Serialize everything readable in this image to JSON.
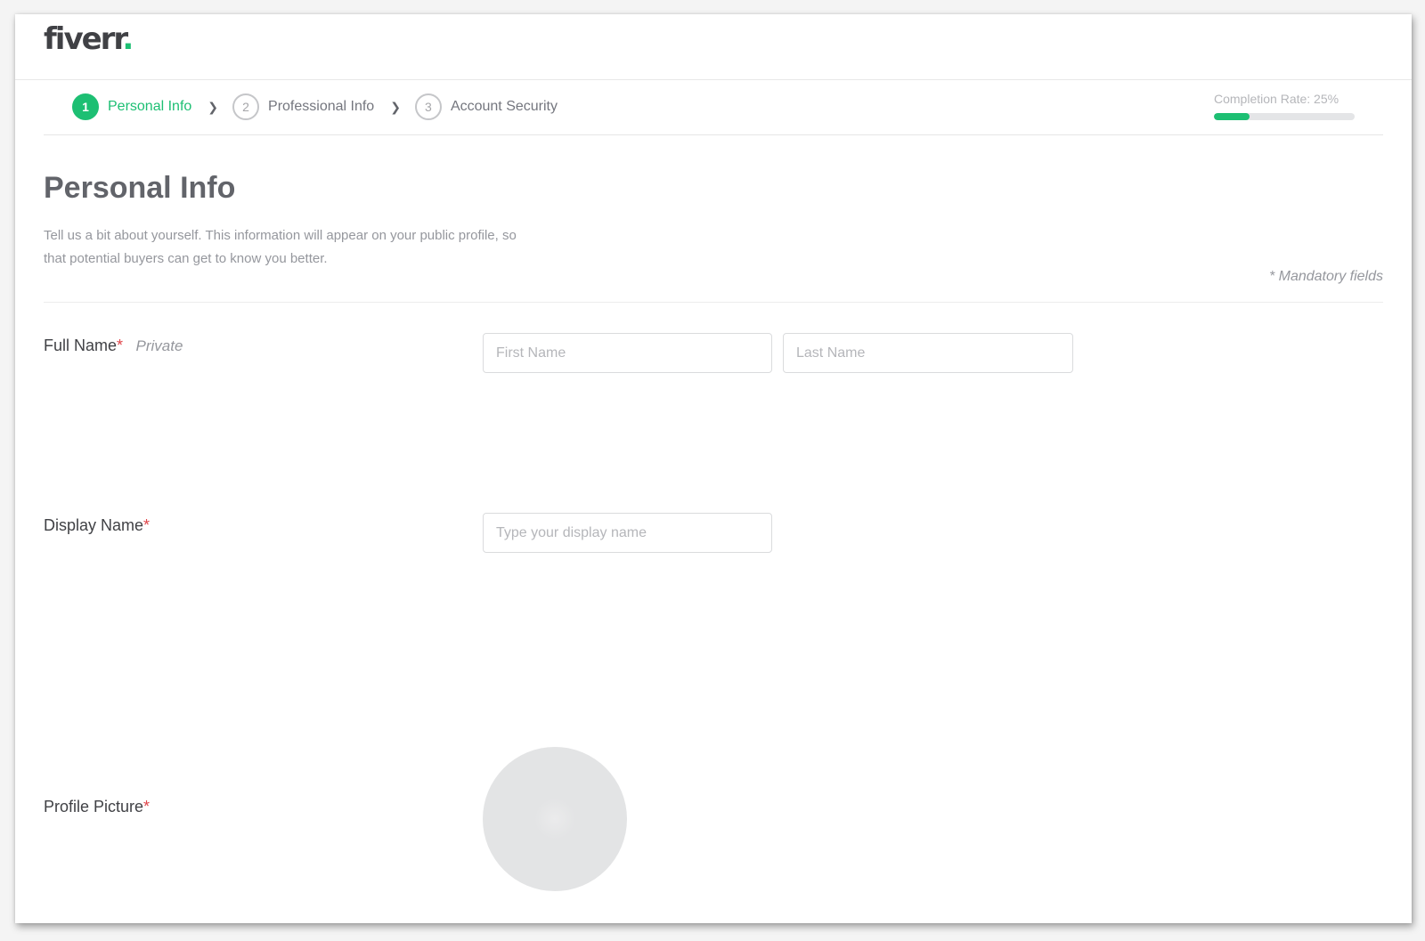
{
  "brand": {
    "logo_text": "fiverr",
    "logo_dot": ".",
    "accent_color": "#1dbf73"
  },
  "steps": [
    {
      "number": "1",
      "label": "Personal Info",
      "active": true
    },
    {
      "number": "2",
      "label": "Professional Info",
      "active": false
    },
    {
      "number": "3",
      "label": "Account Security",
      "active": false
    }
  ],
  "completion": {
    "label": "Completion Rate: 25%",
    "percent": 25
  },
  "page": {
    "title": "Personal Info",
    "description": "Tell us a bit about yourself. This information will appear on your public profile, so that potential buyers can get to know you better.",
    "mandatory_note": "* Mandatory fields"
  },
  "fields": {
    "full_name": {
      "label": "Full Name",
      "required_mark": "*",
      "privacy": "Private",
      "first_placeholder": "First Name",
      "first_value": "",
      "last_placeholder": "Last Name",
      "last_value": ""
    },
    "display_name": {
      "label": "Display Name",
      "required_mark": "*",
      "placeholder": "Type your display name",
      "value": ""
    },
    "profile_picture": {
      "label": "Profile Picture",
      "required_mark": "*"
    }
  }
}
